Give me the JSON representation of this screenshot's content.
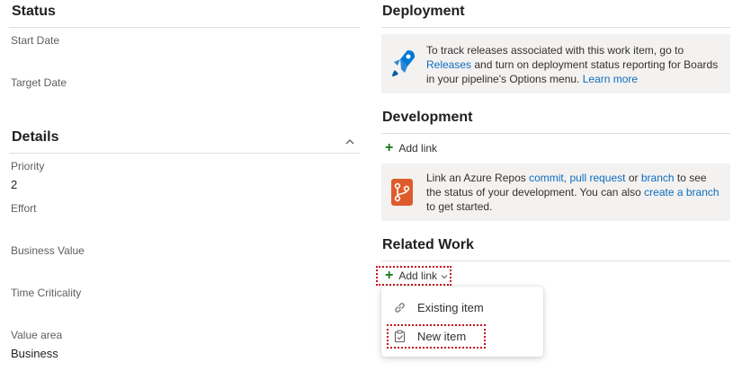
{
  "left": {
    "status": {
      "title": "Status",
      "fields": [
        {
          "label": "Start Date",
          "value": ""
        },
        {
          "label": "Target Date",
          "value": ""
        }
      ]
    },
    "details": {
      "title": "Details",
      "collapse_icon": "chevron-up-icon",
      "fields": [
        {
          "label": "Priority",
          "value": "2"
        },
        {
          "label": "Effort",
          "value": ""
        },
        {
          "label": "Business Value",
          "value": ""
        },
        {
          "label": "Time Criticality",
          "value": ""
        },
        {
          "label": "Value area",
          "value": "Business"
        }
      ]
    }
  },
  "right": {
    "deployment": {
      "title": "Deployment",
      "icon": "rocket-icon",
      "text_1": "To track releases associated with this work item, go to",
      "link_releases": "Releases",
      "text_2": "and turn on deployment status reporting for Boards",
      "text_3": "in your pipeline's Options menu.",
      "link_learn_more": "Learn more"
    },
    "development": {
      "title": "Development",
      "add_link": "Add link",
      "icon": "repo-icon",
      "text_1": "Link an Azure Repos",
      "link_commit": "commit,",
      "link_pull_request": "pull request",
      "text_or": "or",
      "link_branch": "branch",
      "text_2": "to see",
      "text_3": "the status of your development. You can also",
      "link_create_branch": "create a branch",
      "text_4": "to get started."
    },
    "related_work": {
      "title": "Related Work",
      "add_link": "Add link",
      "menu": {
        "items": [
          {
            "label": "Existing item",
            "icon": "link-icon"
          },
          {
            "label": "New item",
            "icon": "new-work-item-icon"
          }
        ]
      }
    }
  },
  "colors": {
    "accent": "#0f6cbd",
    "add_green": "#107c10",
    "highlight": "#c50f1f"
  }
}
